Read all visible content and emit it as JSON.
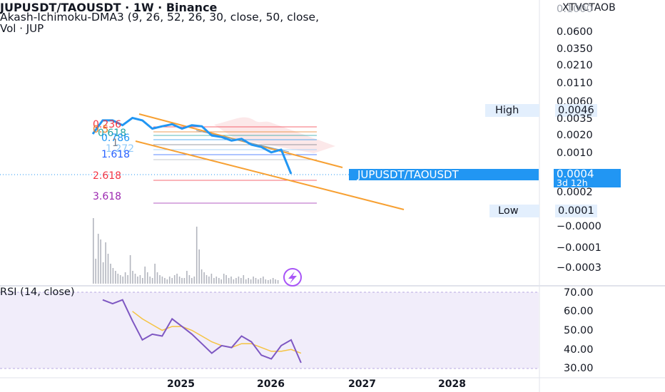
{
  "header": {
    "title": "JUPUSDT/TAOUSDT · 1W · Binance",
    "indicator": "Akash-Ichimoku-DMA3 (9, 26, 52, 26, 30, close, 50, close,",
    "volume": "Vol · JUP"
  },
  "symbol_button": "XTVCTAOB",
  "price_axis": {
    "labels": [
      "0.1000",
      "0.0600",
      "0.0350",
      "0.0210",
      "0.0110",
      "0.0060",
      "0.0046",
      "0.0035",
      "0.0020",
      "0.0010",
      "0.0004",
      "0.0002",
      "0.0001",
      "−0.0000",
      "−0.0001",
      "−0.0003"
    ],
    "high_label": "High",
    "low_label": "Low",
    "current_symbol": "JUPUSDT/TAOUSDT",
    "current_price": "0.0004",
    "countdown": "3d 12h"
  },
  "fib_labels": [
    "0.236",
    "0.5",
    "0.618",
    "0.786",
    "1",
    "1.272",
    "1.618",
    "2.618",
    "3.618"
  ],
  "rsi": {
    "label": "RSI (14, close)",
    "axis": [
      "70.00",
      "60.00",
      "50.00",
      "40.00",
      "30.00"
    ]
  },
  "time_axis": [
    "2025",
    "2026",
    "2027",
    "2028"
  ],
  "colors": {
    "price_line": "#2196f3",
    "channel": "#f7a032",
    "rsi_line": "#7e57c2",
    "rsi_ma": "#f5c342",
    "volume": "#b2b5be",
    "rsi_band": "#f1edfa",
    "fib_red": "#f23645",
    "fib_purple": "#9c27b0"
  },
  "chart_data": [
    {
      "type": "line",
      "title": "JUPUSDT/TAOUSDT · 1W · Binance",
      "ylabel": "",
      "price_scale": "log",
      "x": [
        "2024-07",
        "2024-08",
        "2024-09",
        "2024-10",
        "2024-11",
        "2024-12",
        "2025-01",
        "2025-02",
        "2025-03",
        "2025-04",
        "2025-05",
        "2025-06",
        "2025-07",
        "2025-08",
        "2025-09",
        "2025-10",
        "2025-11",
        "2025-12",
        "2026-01",
        "2026-02",
        "2026-03"
      ],
      "series": [
        {
          "values": [
            0.0018,
            0.003,
            0.003,
            0.0025,
            0.0033,
            0.003,
            0.0022,
            0.0024,
            0.0026,
            0.0022,
            0.0025,
            0.0024,
            0.0017,
            0.0016,
            0.0014,
            0.0015,
            0.0012,
            0.0011,
            0.0009,
            0.001,
            0.0004
          ]
        }
      ],
      "high": 0.0046,
      "low": 0.0001,
      "last": 0.0004
    },
    {
      "type": "line",
      "title": "RSI (14, close)",
      "ylim": [
        30,
        70
      ],
      "x": [
        "2024-07",
        "2024-08",
        "2024-09",
        "2024-10",
        "2024-11",
        "2024-12",
        "2025-01",
        "2025-02",
        "2025-03",
        "2025-04",
        "2025-05",
        "2025-06",
        "2025-07",
        "2025-08",
        "2025-09",
        "2025-10",
        "2025-11",
        "2025-12",
        "2026-01",
        "2026-02",
        "2026-03"
      ],
      "series": [
        {
          "values": [
            66,
            64,
            66,
            55,
            45,
            48,
            47,
            56,
            52,
            48,
            43,
            38,
            42,
            41,
            47,
            44,
            37,
            35,
            42,
            45,
            33
          ]
        },
        {
          "values": [
            null,
            null,
            null,
            60,
            56,
            53,
            50,
            52,
            52,
            50,
            47,
            44,
            42,
            41,
            43,
            43,
            41,
            39,
            39,
            40,
            38
          ]
        }
      ]
    }
  ]
}
